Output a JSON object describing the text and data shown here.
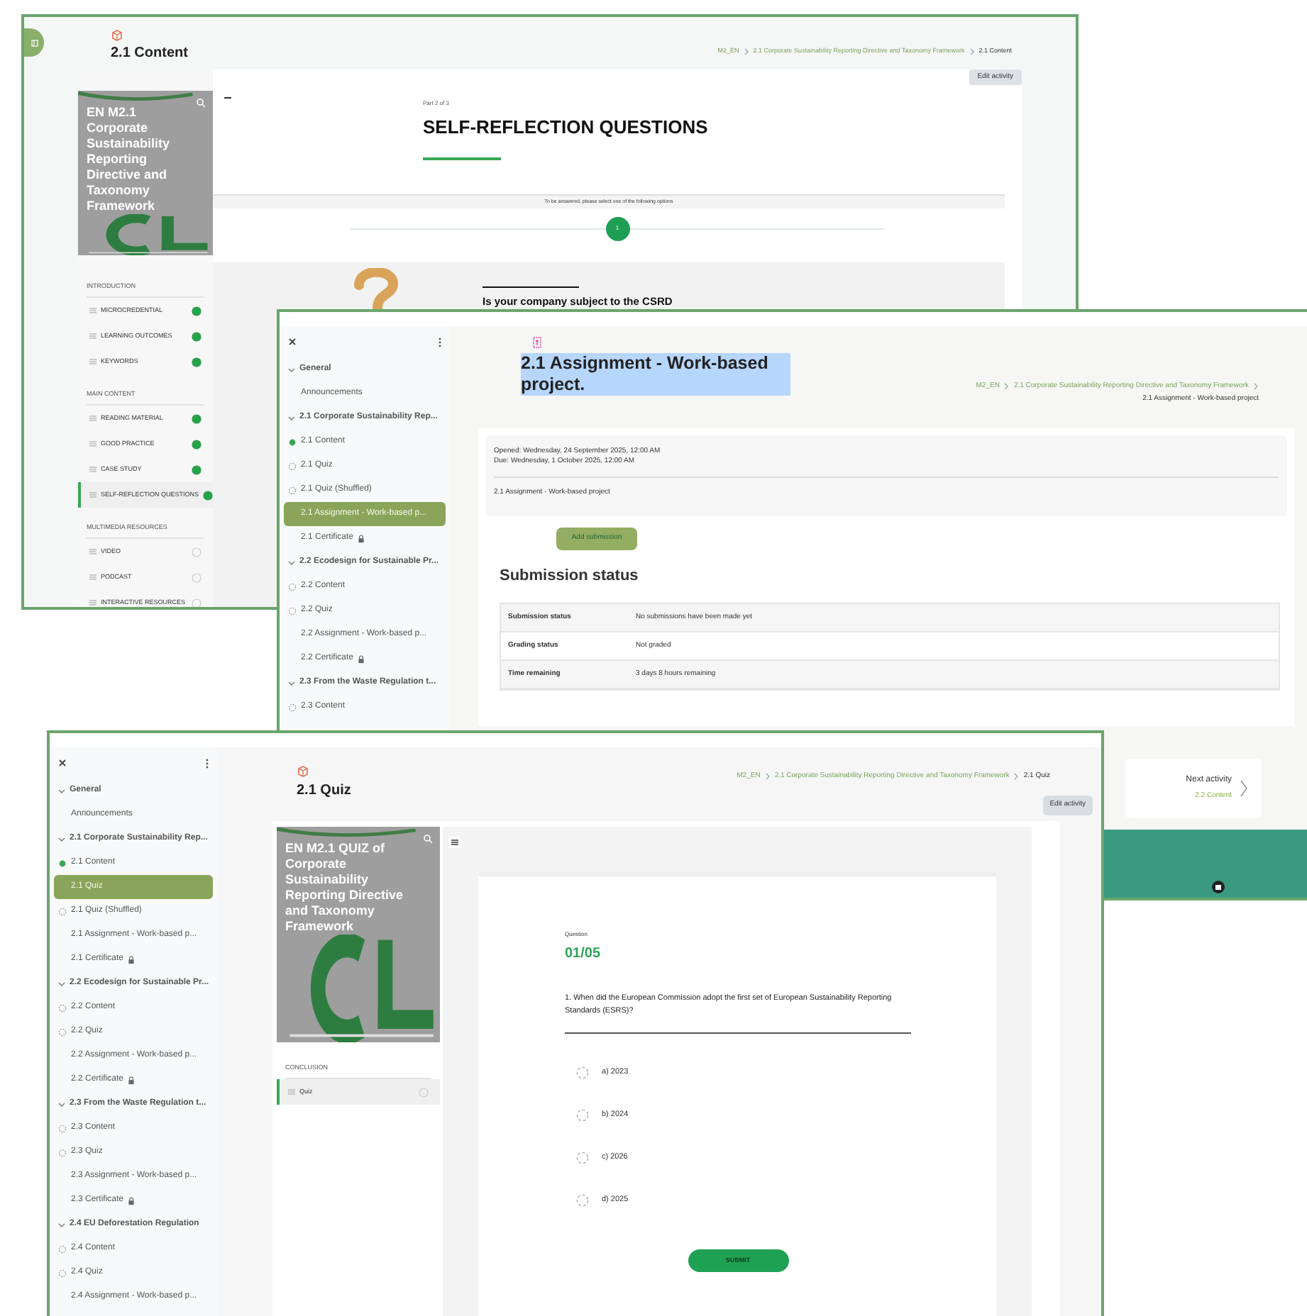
{
  "content_window": {
    "title": "2.1 Content",
    "breadcrumb": [
      {
        "label": "M2_EN",
        "current": false
      },
      {
        "label": "2.1 Corporate Sustainability Reporting Directive and Taxonomy Framework",
        "current": false
      },
      {
        "label": "2.1 Content",
        "current": true
      }
    ],
    "edit_button": "Edit activity",
    "cover_title": "EN M2.1 Corporate Sustainability Reporting Directive and Taxonomy Framework",
    "outline": [
      {
        "heading": "INTRODUCTION",
        "items": [
          {
            "label": "MICROCREDENTIAL",
            "completed": true,
            "selected": false
          },
          {
            "label": "LEARNING OUTCOMES",
            "completed": true,
            "selected": false
          },
          {
            "label": "KEYWORDS",
            "completed": true,
            "selected": false
          }
        ]
      },
      {
        "heading": "MAIN CONTENT",
        "items": [
          {
            "label": "READING MATERIAL",
            "completed": true,
            "selected": false
          },
          {
            "label": "GOOD PRACTICE",
            "completed": true,
            "selected": false
          },
          {
            "label": "CASE STUDY",
            "completed": true,
            "selected": false
          },
          {
            "label": "SELF-REFLECTION QUESTIONS",
            "completed": true,
            "selected": true
          }
        ]
      },
      {
        "heading": "MULTIMEDIA RESOURCES",
        "items": [
          {
            "label": "VIDEO",
            "completed": false,
            "selected": false
          },
          {
            "label": "PODCAST",
            "completed": false,
            "selected": false
          },
          {
            "label": "INTERACTIVE RESOURCES",
            "completed": false,
            "selected": false
          }
        ]
      }
    ],
    "page": {
      "kicker": "Part 2 of 3",
      "heading": "SELF-REFLECTION QUESTIONS",
      "instruction": "To be answered, please select one of the following options",
      "steps": [
        {
          "label": "1",
          "selected": true
        }
      ],
      "question": "Is your company subject to the CSRD"
    }
  },
  "assignment_window": {
    "title": "2.1 Assignment - Work-based project.",
    "breadcrumb": [
      {
        "label": "M2_EN",
        "current": false
      },
      {
        "label": "2.1 Corporate Sustainability Reporting Directive and Taxonomy Framework",
        "current": false
      },
      {
        "label": "2.1 Assignment - Work-based project",
        "current": true
      }
    ],
    "nav": [
      {
        "kind": "section",
        "label": "General",
        "expanded": true,
        "selected": false,
        "children": [
          {
            "kind": "page",
            "label": "Announcements",
            "locked": false,
            "selected": false
          }
        ]
      },
      {
        "kind": "section",
        "label": "2.1 Corporate Sustainability Rep...",
        "expanded": true,
        "selected": false,
        "children": [
          {
            "kind": "activity",
            "label": "2.1 Content",
            "completed": true,
            "selected": false
          },
          {
            "kind": "activity",
            "label": "2.1 Quiz",
            "completed": false,
            "selected": false
          },
          {
            "kind": "activity",
            "label": "2.1 Quiz (Shuffled)",
            "completed": false,
            "selected": false
          },
          {
            "kind": "page",
            "label": "2.1 Assignment - Work-based p...",
            "locked": false,
            "selected": true
          },
          {
            "kind": "page",
            "label": "2.1 Certificate",
            "locked": true,
            "selected": false
          }
        ]
      },
      {
        "kind": "section",
        "label": "2.2 Ecodesign for Sustainable Pr...",
        "expanded": true,
        "selected": false,
        "children": [
          {
            "kind": "activity",
            "label": "2.2 Content",
            "completed": false,
            "selected": false
          },
          {
            "kind": "activity",
            "label": "2.2 Quiz",
            "completed": false,
            "selected": false
          },
          {
            "kind": "page",
            "label": "2.2 Assignment - Work-based p...",
            "locked": false,
            "selected": false
          },
          {
            "kind": "page",
            "label": "2.2 Certificate",
            "locked": true,
            "selected": false
          }
        ]
      },
      {
        "kind": "section",
        "label": "2.3 From the Waste Regulation t...",
        "expanded": true,
        "selected": false,
        "children": [
          {
            "kind": "activity",
            "label": "2.3 Content",
            "completed": false,
            "selected": false
          }
        ]
      }
    ],
    "dates": [
      "Opened: Wednesday, 24 September 2025, 12:00 AM",
      "Due: Wednesday, 1 October 2025, 12:00 AM"
    ],
    "description": "2.1 Assignment - Work-based project",
    "add_button": "Add submission",
    "status_heading": "Submission status",
    "status_rows": [
      {
        "label": "Submission status",
        "value": "No submissions have been made yet"
      },
      {
        "label": "Grading status",
        "value": "Not graded"
      },
      {
        "label": "Time remaining",
        "value": "3 days 8 hours remaining"
      }
    ],
    "next_activity": {
      "label": "Next activity",
      "target": "2.2 Content"
    }
  },
  "quiz_window": {
    "title": "2.1 Quiz",
    "breadcrumb": [
      {
        "label": "M2_EN",
        "current": false
      },
      {
        "label": "2.1 Corporate Sustainability Reporting Directive and Taxonomy Framework",
        "current": false
      },
      {
        "label": "2.1 Quiz",
        "current": true
      }
    ],
    "edit_button": "Edit activity",
    "nav": [
      {
        "kind": "section",
        "label": "General",
        "expanded": true,
        "selected": false,
        "children": [
          {
            "kind": "page",
            "label": "Announcements",
            "locked": false,
            "selected": false
          }
        ]
      },
      {
        "kind": "section",
        "label": "2.1 Corporate Sustainability Rep...",
        "expanded": true,
        "selected": false,
        "children": [
          {
            "kind": "activity",
            "label": "2.1 Content",
            "completed": true,
            "selected": false
          },
          {
            "kind": "activity",
            "label": "2.1 Quiz",
            "completed": false,
            "selected": true
          },
          {
            "kind": "activity",
            "label": "2.1 Quiz (Shuffled)",
            "completed": false,
            "selected": false
          },
          {
            "kind": "page",
            "label": "2.1 Assignment - Work-based p...",
            "locked": false,
            "selected": false
          },
          {
            "kind": "page",
            "label": "2.1 Certificate",
            "locked": true,
            "selected": false
          }
        ]
      },
      {
        "kind": "section",
        "label": "2.2 Ecodesign for Sustainable Pr...",
        "expanded": true,
        "selected": false,
        "children": [
          {
            "kind": "activity",
            "label": "2.2 Content",
            "completed": false,
            "selected": false
          },
          {
            "kind": "activity",
            "label": "2.2 Quiz",
            "completed": false,
            "selected": false
          },
          {
            "kind": "page",
            "label": "2.2 Assignment - Work-based p...",
            "locked": false,
            "selected": false
          },
          {
            "kind": "page",
            "label": "2.2 Certificate",
            "locked": true,
            "selected": false
          }
        ]
      },
      {
        "kind": "section",
        "label": "2.3 From the Waste Regulation t...",
        "expanded": true,
        "selected": false,
        "children": [
          {
            "kind": "activity",
            "label": "2.3 Content",
            "completed": false,
            "selected": false
          },
          {
            "kind": "activity",
            "label": "2.3 Quiz",
            "completed": false,
            "selected": false
          },
          {
            "kind": "page",
            "label": "2.3 Assignment - Work-based p...",
            "locked": false,
            "selected": false
          },
          {
            "kind": "page",
            "label": "2.3 Certificate",
            "locked": true,
            "selected": false
          }
        ]
      },
      {
        "kind": "section",
        "label": "2.4 EU Deforestation Regulation",
        "expanded": true,
        "selected": false,
        "children": [
          {
            "kind": "activity",
            "label": "2.4 Content",
            "completed": false,
            "selected": false
          },
          {
            "kind": "activity",
            "label": "2.4 Quiz",
            "completed": false,
            "selected": false
          },
          {
            "kind": "page",
            "label": "2.4 Assignment - Work-based p...",
            "locked": false,
            "selected": false
          }
        ]
      }
    ],
    "cover_title": "EN M2.1 QUIZ of Corporate Sustainability Reporting Directive and Taxonomy Framework",
    "outline": [
      {
        "heading": "CONCLUSION",
        "items": [
          {
            "label": "Quiz",
            "completed": false,
            "selected": true
          }
        ]
      }
    ],
    "question": {
      "label": "Question",
      "number": "01/05",
      "text": "1. When did the European Commission adopt the first set of European Sustainability Reporting Standards (ESRS)?",
      "options": [
        {
          "label": "a) 2023",
          "selected": false
        },
        {
          "label": "b) 2024",
          "selected": false
        },
        {
          "label": "c) 2026",
          "selected": false
        },
        {
          "label": "d) 2025",
          "selected": false
        }
      ],
      "submit": "SUBMIT"
    }
  }
}
